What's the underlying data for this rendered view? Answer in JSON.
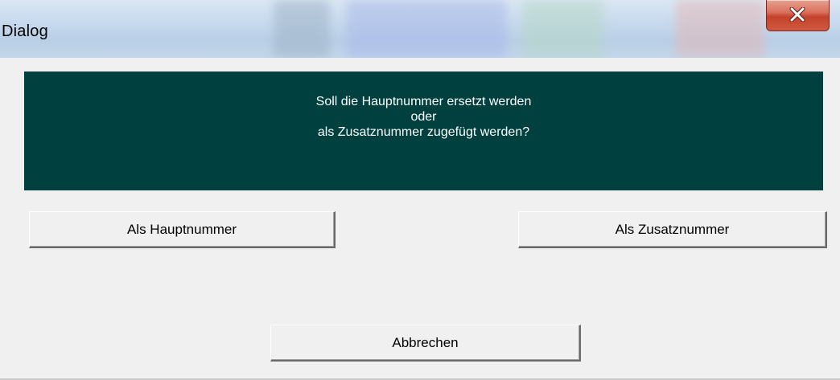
{
  "window": {
    "title": "Dialog"
  },
  "message": {
    "lines": [
      "Soll die Hauptnummer ersetzt werden",
      "oder",
      "als Zusatznummer zugefügt werden?"
    ]
  },
  "buttons": {
    "haupt_label": "Als Hauptnummer",
    "zusatz_label": "Als Zusatznummer",
    "cancel_label": "Abbrechen"
  },
  "icons": {
    "close": "close-icon"
  },
  "colors": {
    "message_background": "#00403f",
    "message_text": "#ffffff",
    "dialog_background": "#f0f0f0",
    "close_button": "#c4422d"
  }
}
